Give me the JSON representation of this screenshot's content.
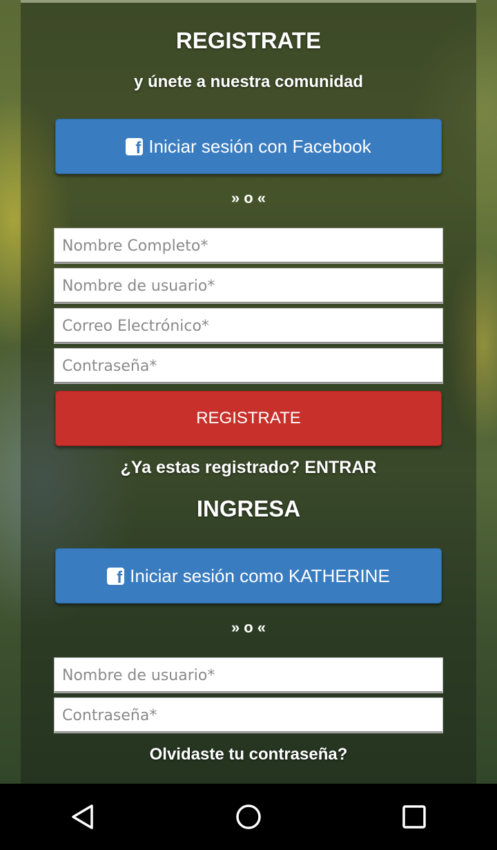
{
  "register": {
    "title": "REGISTRATE",
    "subtitle": "y únete a nuestra comunidad",
    "facebook_button_label": "Iniciar sesión con Facebook",
    "divider_text": "o",
    "fields": {
      "full_name_placeholder": "Nombre Completo*",
      "username_placeholder": "Nombre de usuario*",
      "email_placeholder": "Correo Electrónico*",
      "password_placeholder": "Contraseña*"
    },
    "submit_label": "REGISTRATE",
    "already_registered_link": "¿Ya estas registrado? ENTRAR"
  },
  "login": {
    "title": "INGRESA",
    "facebook_button_label": "Iniciar sesión como KATHERINE",
    "divider_text": "o",
    "fields": {
      "username_placeholder": "Nombre de usuario*",
      "password_placeholder": "Contraseña*"
    },
    "forgot_password_link": "Olvidaste tu contraseña?"
  },
  "nav_bar": {
    "icons": [
      "back-triangle-icon",
      "home-circle-icon",
      "recents-square-icon"
    ]
  },
  "colors": {
    "facebook_blue": "#3a7cc0",
    "register_red": "#c8302c"
  }
}
